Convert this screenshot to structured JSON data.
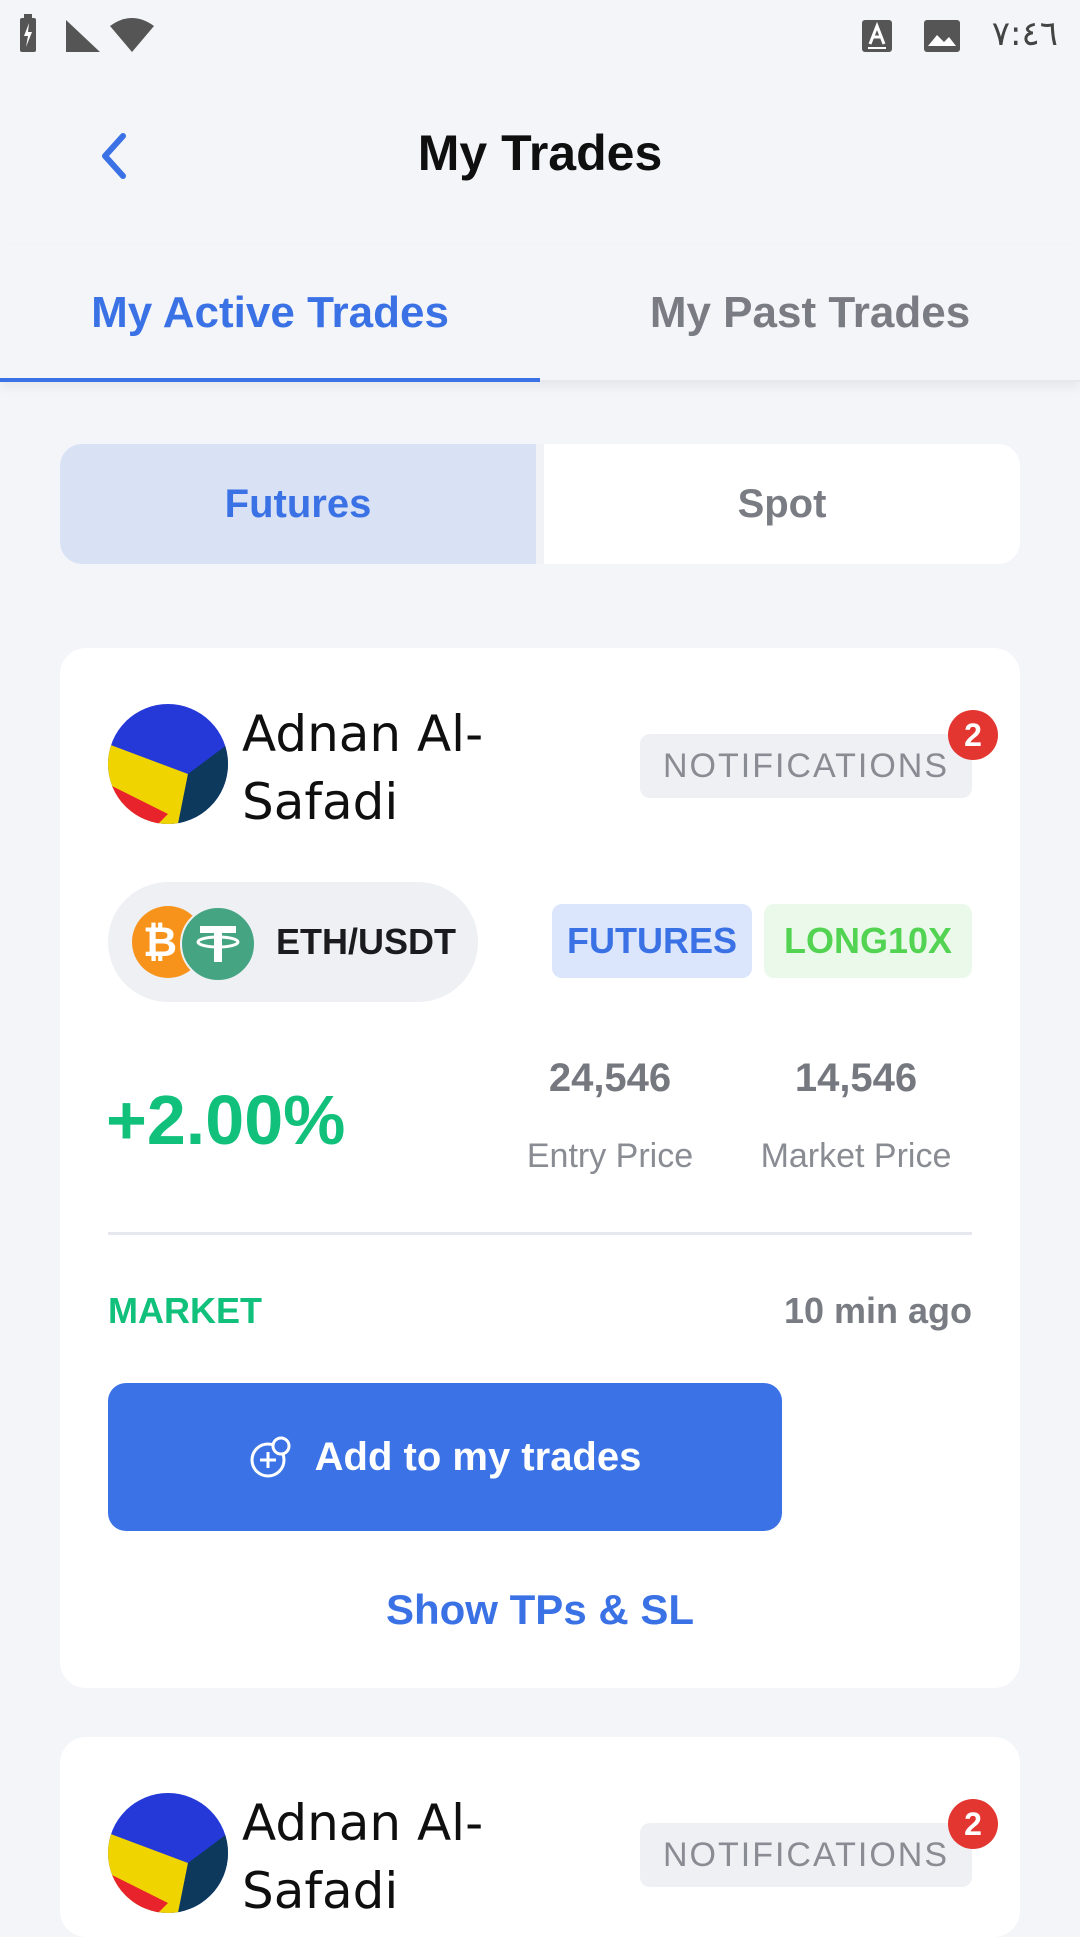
{
  "status_bar": {
    "time": "٧:٤٦",
    "icons": [
      "battery-charging-icon",
      "cellular-signal-icon",
      "wifi-icon",
      "keyboard-a-icon",
      "image-icon"
    ]
  },
  "header": {
    "title": "My Trades",
    "back_icon": "chevron-left-icon"
  },
  "main_tabs": [
    {
      "label": "My Active Trades",
      "active": true
    },
    {
      "label": "My Past Trades",
      "active": false
    }
  ],
  "segmented": [
    {
      "label": "Futures",
      "active": true
    },
    {
      "label": "Spot",
      "active": false
    }
  ],
  "trades": [
    {
      "trader_name": "Adnan Al-Safadi",
      "notifications_label": "NOTIFICATIONS",
      "notifications_count": "2",
      "pair": "ETH/USDT",
      "market_type_tag": "FUTURES",
      "direction_tag": "LONG10X",
      "pnl": "+2.00%",
      "entry_price": "24,546",
      "entry_price_label": "Entry Price",
      "market_price": "14,546",
      "market_price_label": "Market Price",
      "order_type": "MARKET",
      "time_ago": "10 min ago",
      "add_button_label": "Add to my trades",
      "show_tps_label": "Show TPs & SL"
    },
    {
      "trader_name": "Adnan Al-Safadi",
      "notifications_label": "NOTIFICATIONS",
      "notifications_count": "2"
    }
  ],
  "colors": {
    "accent": "#3a72e6",
    "positive": "#10c07b",
    "long_tag": "#53d352",
    "badge": "#e43631",
    "background": "#f3f5f8"
  }
}
